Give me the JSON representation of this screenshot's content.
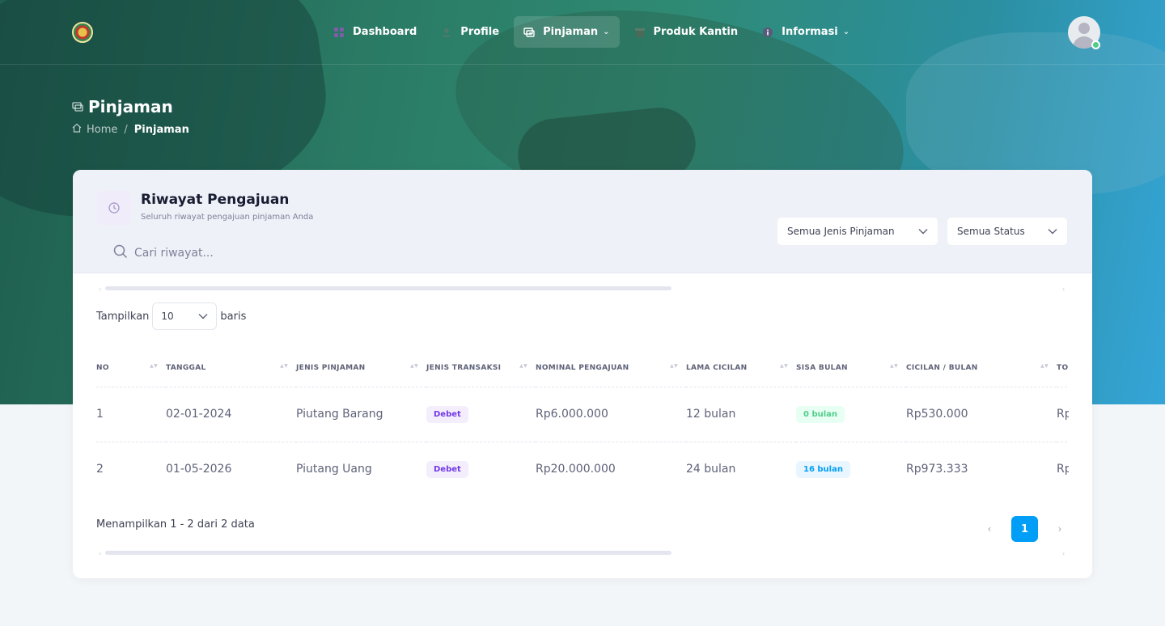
{
  "nav": {
    "items": [
      {
        "label": "Dashboard",
        "icon": "dashboard-icon"
      },
      {
        "label": "Profile",
        "icon": "user-icon"
      },
      {
        "label": "Pinjaman",
        "icon": "money-icon"
      },
      {
        "label": "Produk Kantin",
        "icon": "store-icon"
      },
      {
        "label": "Informasi",
        "icon": "info-icon"
      }
    ],
    "active": "Pinjaman"
  },
  "page": {
    "title": "Pinjaman",
    "breadcrumb": {
      "home": "Home",
      "separator": "/",
      "current": "Pinjaman"
    }
  },
  "card": {
    "title": "Riwayat Pengajuan",
    "subtitle": "Seluruh riwayat pengajuan pinjaman Anda",
    "search_placeholder": "Cari riwayat...",
    "filter_type": "Semua Jenis Pinjaman",
    "filter_status": "Semua Status"
  },
  "length": {
    "prefix": "Tampilkan",
    "value": "10",
    "suffix": "baris"
  },
  "table": {
    "columns": [
      "NO",
      "TANGGAL",
      "JENIS PINJAMAN",
      "JENIS TRANSAKSI",
      "NOMINAL PENGAJUAN",
      "LAMA CICILAN",
      "SISA BULAN",
      "CICILAN / BULAN",
      "TO"
    ],
    "rows": [
      {
        "no": "1",
        "tanggal": "02-01-2024",
        "jenis": "Piutang Barang",
        "transaksi": "Debet",
        "nominal": "Rp6.000.000",
        "lama": "12 bulan",
        "sisa": "0 bulan",
        "sisa_color": "green",
        "cicilan": "Rp530.000",
        "total": "Rp"
      },
      {
        "no": "2",
        "tanggal": "01-05-2026",
        "jenis": "Piutang Uang",
        "transaksi": "Debet",
        "nominal": "Rp20.000.000",
        "lama": "24 bulan",
        "sisa": "16 bulan",
        "sisa_color": "blue",
        "cicilan": "Rp973.333",
        "total": "Rp"
      }
    ]
  },
  "footer": {
    "info": "Menampilkan 1 - 2 dari 2 data",
    "prev": "‹",
    "page": "1",
    "next": "›"
  },
  "colors": {
    "accent": "#009ef7",
    "success": "#50cd89",
    "purple": "#7239ea"
  }
}
